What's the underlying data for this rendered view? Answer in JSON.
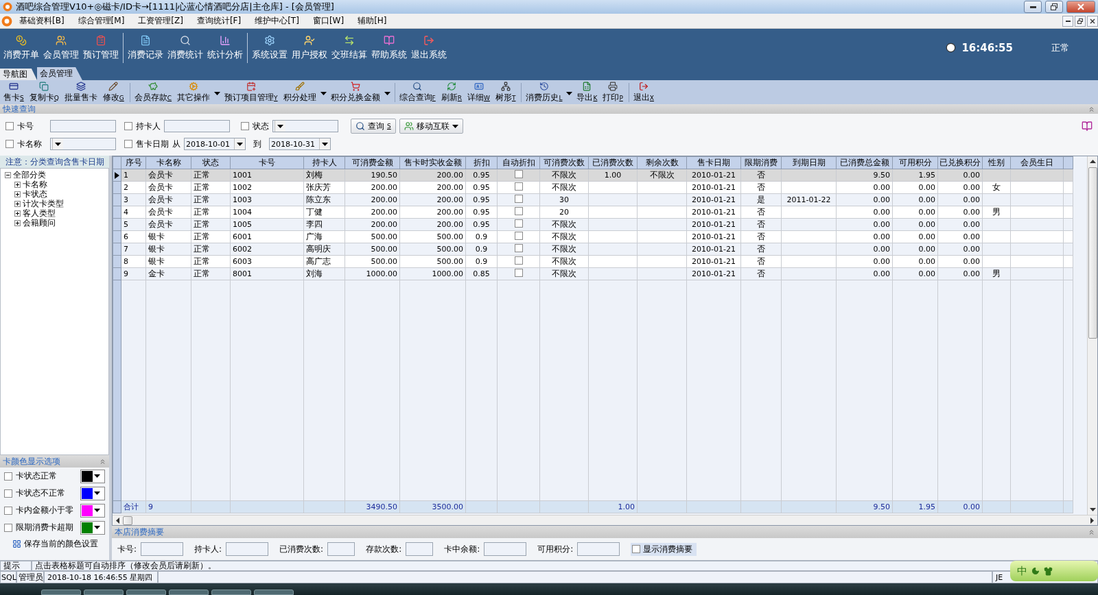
{
  "window": {
    "title": "酒吧综合管理V10+◎磁卡/ID卡→[1111|心蓝心情酒吧分店|主仓库] - [会员管理]"
  },
  "menu": [
    "基础资料[B]",
    "综合管理[M]",
    "工资管理[Z]",
    "查询统计[F]",
    "维护中心[T]",
    "窗口[W]",
    "辅助[H]"
  ],
  "main_toolbar": [
    [
      "消费开单",
      "会员管理",
      "预订管理"
    ],
    [
      "消费记录",
      "消费统计",
      "统计分析"
    ],
    [
      "系统设置",
      "用户授权",
      "交班结算",
      "帮助系统",
      "退出系统"
    ]
  ],
  "clock": "16:46:55",
  "status": "正常",
  "tabs": [
    {
      "label": "导航图",
      "selected": false
    },
    {
      "label": "会员管理",
      "selected": true
    }
  ],
  "toolbar": [
    [
      {
        "label": "售卡",
        "key": "S",
        "menu": false
      },
      {
        "label": "复制卡",
        "key": "Q",
        "menu": false
      },
      {
        "label": "批量售卡",
        "menu": false
      },
      {
        "label": "修改",
        "key": "G",
        "menu": false
      }
    ],
    [
      {
        "label": "会员存款",
        "key": "C",
        "menu": false
      },
      {
        "label": "其它操作",
        "menu": true
      },
      {
        "label": "预订项目管理",
        "key": "Y",
        "menu": false
      },
      {
        "label": "积分处理",
        "menu": true
      },
      {
        "label": "积分兑换金额",
        "menu": true
      }
    ],
    [
      {
        "label": "综合查询",
        "key": "F",
        "menu": false
      },
      {
        "label": "刷新",
        "key": "R",
        "menu": false
      },
      {
        "label": "详细",
        "key": "W",
        "menu": false
      },
      {
        "label": "树形",
        "key": "T",
        "menu": false
      }
    ],
    [
      {
        "label": "消费历史",
        "key": "L",
        "menu": true
      },
      {
        "label": "导出",
        "key": "K",
        "menu": false
      },
      {
        "label": "打印",
        "key": "P",
        "menu": false
      }
    ],
    [
      {
        "label": "退出",
        "key": "X",
        "menu": false
      }
    ]
  ],
  "quick_query": {
    "title": "快速查询",
    "card_no": {
      "label": "卡号",
      "checked": false
    },
    "holder": {
      "label": "持卡人",
      "checked": false
    },
    "state": {
      "label": "状态",
      "checked": false
    },
    "card_name": {
      "label": "卡名称",
      "checked": false
    },
    "sale_date": {
      "label": "售卡日期",
      "checked": false,
      "from_label": "从",
      "from": "2018-10-01",
      "to_label": "到",
      "to": "2018-10-31"
    },
    "query_button": {
      "label": "查询",
      "key": "S"
    },
    "mobile_button": {
      "label": "移动互联"
    }
  },
  "category_panel": {
    "note": "注意：分类查询含售卡日期",
    "tree": [
      {
        "label": "全部分类",
        "expanded": true,
        "children": [
          {
            "label": "卡名称",
            "expanded": false
          },
          {
            "label": "卡状态",
            "expanded": false
          },
          {
            "label": "计次卡类型",
            "expanded": false
          },
          {
            "label": "客人类型",
            "expanded": false
          },
          {
            "label": "会籍顾问",
            "expanded": false
          }
        ]
      }
    ]
  },
  "color_options": {
    "title": "卡颜色显示选项",
    "items": [
      {
        "label": "卡状态正常",
        "checked": false,
        "color": "#000000"
      },
      {
        "label": "卡状态不正常",
        "checked": false,
        "color": "#0000ff"
      },
      {
        "label": "卡内金额小于零",
        "checked": false,
        "color": "#ff00ff"
      },
      {
        "label": "限期消费卡超期",
        "checked": false,
        "color": "#008000"
      }
    ],
    "save_button": "保存当前的颜色设置"
  },
  "table": {
    "columns": [
      "序号",
      "卡名称",
      "状态",
      "卡号",
      "持卡人",
      "可消费金额",
      "售卡时实收金额",
      "折扣",
      "自动折扣",
      "可消费次数",
      "已消费次数",
      "剩余次数",
      "售卡日期",
      "限期消费",
      "到期日期",
      "已消费总金额",
      "可用积分",
      "已兑换积分",
      "性别",
      "会员生日"
    ],
    "rows": [
      {
        "selected": true,
        "auto_discount": false,
        "cells": [
          "1",
          "会员卡",
          "正常",
          "1001",
          "刘梅",
          "190.50",
          "200.00",
          "0.95",
          null,
          "不限次",
          "1.00",
          "不限次",
          "2010-01-21",
          "否",
          null,
          "9.50",
          "1.95",
          "0.00",
          null,
          null
        ]
      },
      {
        "selected": false,
        "auto_discount": false,
        "cells": [
          "2",
          "会员卡",
          "正常",
          "1002",
          "张庆芳",
          "200.00",
          "200.00",
          "0.95",
          null,
          "不限次",
          null,
          null,
          "2010-01-21",
          "否",
          null,
          "0.00",
          "0.00",
          "0.00",
          "女",
          null
        ]
      },
      {
        "selected": false,
        "auto_discount": false,
        "cells": [
          "3",
          "会员卡",
          "正常",
          "1003",
          "陈立东",
          "200.00",
          "200.00",
          "0.95",
          null,
          "30",
          null,
          null,
          "2010-01-21",
          "是",
          "2011-01-22",
          "0.00",
          "0.00",
          "0.00",
          null,
          null
        ]
      },
      {
        "selected": false,
        "auto_discount": false,
        "cells": [
          "4",
          "会员卡",
          "正常",
          "1004",
          "丁健",
          "200.00",
          "200.00",
          "0.95",
          null,
          "20",
          null,
          null,
          "2010-01-21",
          "否",
          null,
          "0.00",
          "0.00",
          "0.00",
          "男",
          null
        ]
      },
      {
        "selected": false,
        "auto_discount": false,
        "cells": [
          "5",
          "会员卡",
          "正常",
          "1005",
          "李四",
          "200.00",
          "200.00",
          "0.95",
          null,
          "不限次",
          null,
          null,
          "2010-01-21",
          "否",
          null,
          "0.00",
          "0.00",
          "0.00",
          null,
          null
        ]
      },
      {
        "selected": false,
        "auto_discount": false,
        "cells": [
          "6",
          "银卡",
          "正常",
          "6001",
          "广海",
          "500.00",
          "500.00",
          "0.9",
          null,
          "不限次",
          null,
          null,
          "2010-01-21",
          "否",
          null,
          "0.00",
          "0.00",
          "0.00",
          null,
          null
        ]
      },
      {
        "selected": false,
        "auto_discount": false,
        "cells": [
          "7",
          "银卡",
          "正常",
          "6002",
          "高明庆",
          "500.00",
          "500.00",
          "0.9",
          null,
          "不限次",
          null,
          null,
          "2010-01-21",
          "否",
          null,
          "0.00",
          "0.00",
          "0.00",
          null,
          null
        ]
      },
      {
        "selected": false,
        "auto_discount": false,
        "cells": [
          "8",
          "银卡",
          "正常",
          "6003",
          "高广志",
          "500.00",
          "500.00",
          "0.9",
          null,
          "不限次",
          null,
          null,
          "2010-01-21",
          "否",
          null,
          "0.00",
          "0.00",
          "0.00",
          null,
          null
        ]
      },
      {
        "selected": false,
        "auto_discount": false,
        "cells": [
          "9",
          "金卡",
          "正常",
          "8001",
          "刘海",
          "1000.00",
          "1000.00",
          "0.85",
          null,
          "不限次",
          null,
          null,
          "2010-01-21",
          "否",
          null,
          "0.00",
          "0.00",
          "0.00",
          "男",
          null
        ]
      }
    ],
    "totals": {
      "label": "合计",
      "count": "9",
      "balance": "3490.50",
      "received": "3500.00",
      "used_times": "1.00",
      "spent": "9.50",
      "points": "1.95",
      "redeemed": "0.00"
    }
  },
  "summary": {
    "title": "本店消费摘要",
    "fields": [
      "卡号:",
      "持卡人:",
      "已消费次数:",
      "存款次数:",
      "卡中余额:",
      "可用积分:"
    ],
    "show_summary": {
      "label": "显示消费摘要",
      "checked": false
    }
  },
  "hint": {
    "label": "提示",
    "text": "点击表格标题可自动排序（修改会员后请刷新）。"
  },
  "status_bar": {
    "mode": "SQL",
    "user": "管理员",
    "datetime": "2018-10-18 16:46:55 星期四",
    "input_method": "JE"
  },
  "ime": {
    "mode": "中"
  }
}
